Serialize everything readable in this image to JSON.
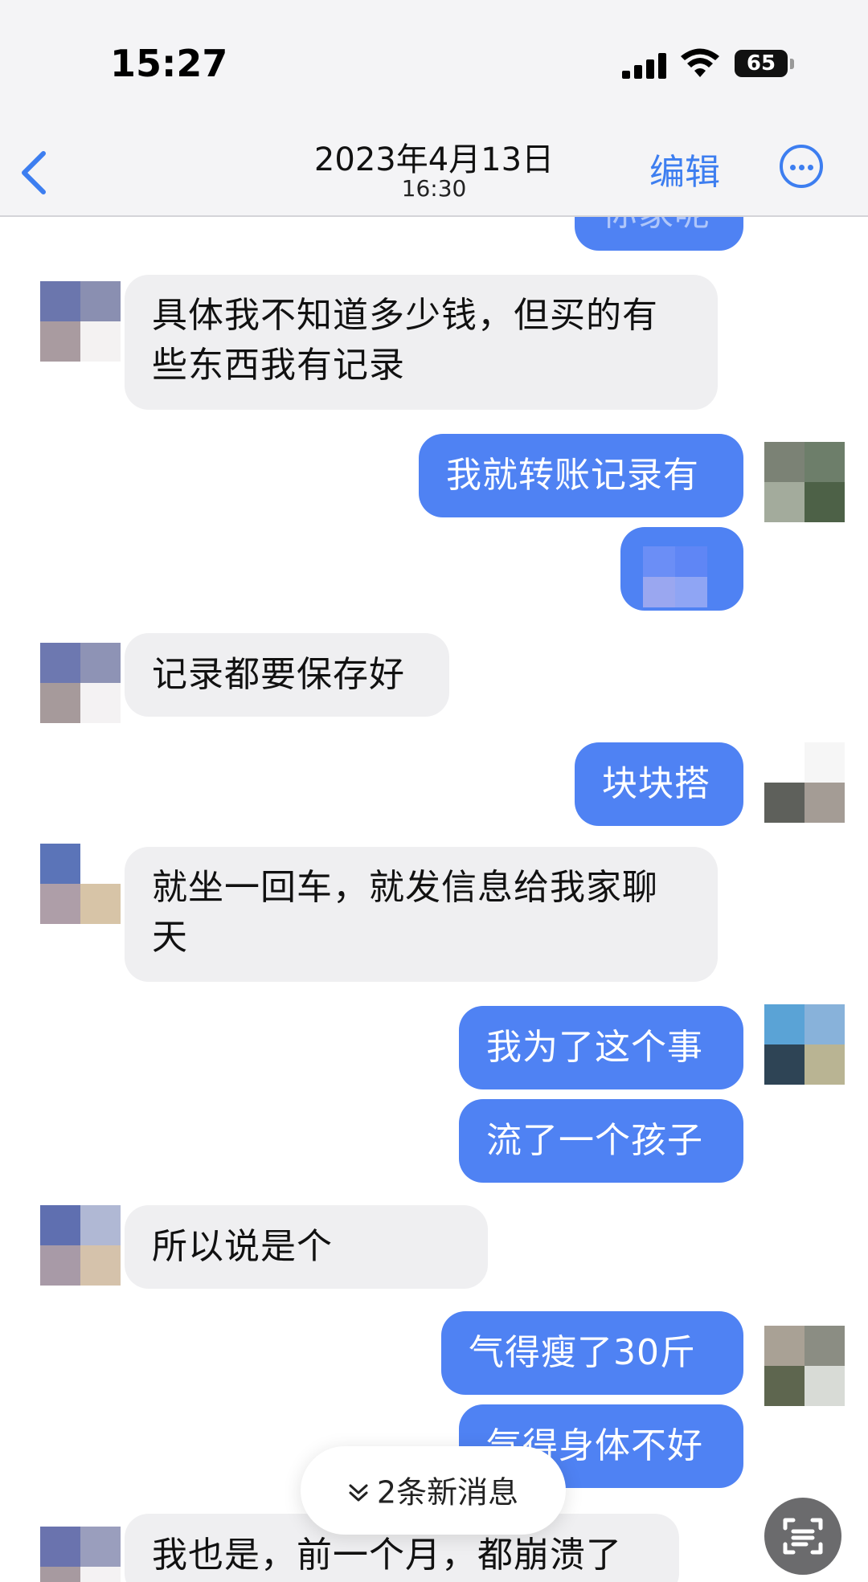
{
  "status_bar": {
    "time": "15:27",
    "battery": "65"
  },
  "header": {
    "date": "2023年4月13日",
    "time": "16:30",
    "edit_label": "编辑"
  },
  "messages": [
    {
      "side": "right",
      "text": "你家呢"
    },
    {
      "side": "left",
      "text_line1": "具体我不知道多少钱，但买的有",
      "text_line2": "些东西我有记录"
    },
    {
      "side": "right",
      "text": "我就转账记录有"
    },
    {
      "side": "right",
      "text": ""
    },
    {
      "side": "left",
      "text": "记录都要保存好"
    },
    {
      "side": "right",
      "text": "块块搭"
    },
    {
      "side": "left",
      "text_line1": "就坐一回车，就发信息给我家聊",
      "text_line2": "天"
    },
    {
      "side": "right",
      "text": "我为了这个事"
    },
    {
      "side": "right",
      "text": "流了一个孩子"
    },
    {
      "side": "left",
      "text": "所以说是个"
    },
    {
      "side": "right",
      "text": "气得瘦了30斤"
    },
    {
      "side": "right",
      "text": "气得身体不好"
    },
    {
      "side": "left",
      "text": "我也是，前一个月，都崩溃了"
    }
  ],
  "new_messages_label": "2条新消息",
  "colors": {
    "accent": "#3d7ef0",
    "outgoing_bubble": "#4f82f3",
    "incoming_bubble": "#efeff1"
  }
}
